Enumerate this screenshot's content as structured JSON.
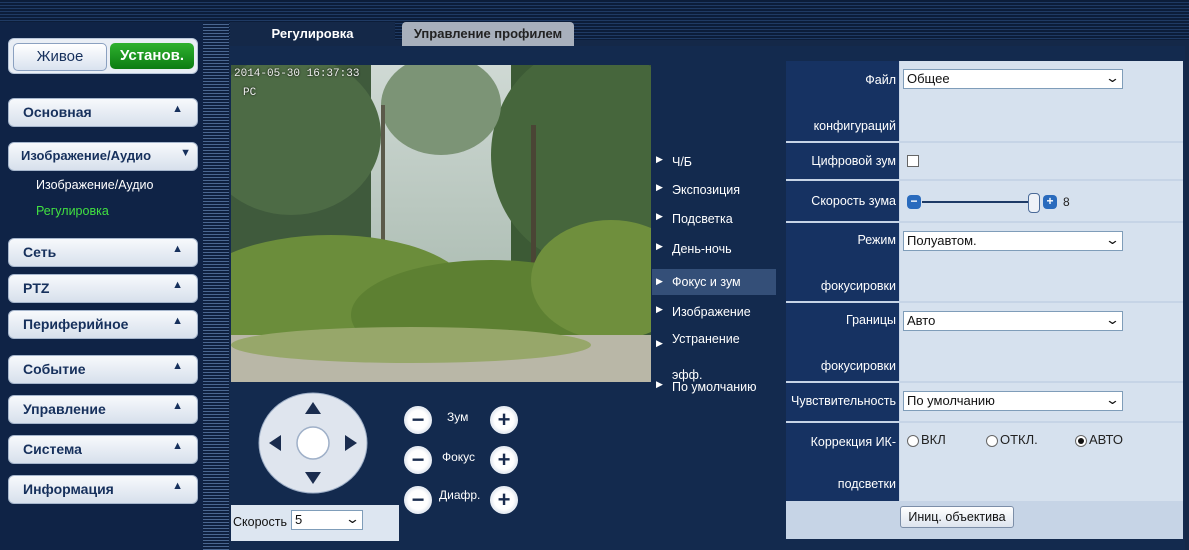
{
  "nav": {
    "live": "Живое",
    "setup": "Установ."
  },
  "sidebar": {
    "menu": [
      {
        "label": "Основная",
        "arrow": "▲"
      },
      {
        "label": "Изображение/Аудио",
        "arrow": "▼"
      },
      {
        "label": "Сеть",
        "arrow": "▲"
      },
      {
        "label": "PTZ",
        "arrow": "▲"
      },
      {
        "label": "Периферийное",
        "arrow": "▲"
      },
      {
        "label": "Событие",
        "arrow": "▲"
      },
      {
        "label": "Управление",
        "arrow": "▲"
      },
      {
        "label": "Система",
        "arrow": "▲"
      },
      {
        "label": "Информация",
        "arrow": "▲"
      }
    ],
    "subitems": [
      {
        "label": "Изображение/Аудио"
      },
      {
        "label": "Регулировка"
      }
    ]
  },
  "tabs": [
    {
      "label": "Регулировка"
    },
    {
      "label": "Управление профилем"
    }
  ],
  "video": {
    "timestamp": "2014-05-30 16:37:33",
    "channel": "PC"
  },
  "ptz": {
    "speed_label": "Скорость",
    "speed_value": "5",
    "zoom": "Зум",
    "focus": "Фокус",
    "iris": "Диафр."
  },
  "sidemenu": [
    {
      "label": "Ч/Б"
    },
    {
      "label": "Экспозиция"
    },
    {
      "label": "Подсветка"
    },
    {
      "label": "День-ночь"
    },
    {
      "label": "Фокус и зум"
    },
    {
      "label": "Изображение"
    },
    {
      "label": "Устранение",
      "label2": "эфф."
    },
    {
      "label": "По умолчанию"
    }
  ],
  "settings": {
    "config_file_l1": "Файл",
    "config_file_l2": "конфигураций",
    "config_file_value": "Общее",
    "digital_zoom": "Цифровой зум",
    "digital_zoom_checked": false,
    "zoom_speed": "Скорость зума",
    "zoom_speed_value": "8",
    "focus_mode_l1": "Режим",
    "focus_mode_l2": "фокусировки",
    "focus_mode_value": "Полуавтом.",
    "focus_limit_l1": "Границы",
    "focus_limit_l2": "фокусировки",
    "focus_limit_value": "Авто",
    "sensitivity": "Чувствительность",
    "sensitivity_value": "По умолчанию",
    "ir_correction_l1": "Коррекция ИК-",
    "ir_correction_l2": "подсветки",
    "ir_on": "ВКЛ",
    "ir_off": "ОТКЛ.",
    "ir_auto": "АВТО",
    "ir_selected": "АВТО",
    "lens_init": "Иниц. объектива"
  },
  "colors": {
    "active_menu": "#41e041",
    "setup_button": "#1c9a20",
    "panel_label": "#163262"
  }
}
